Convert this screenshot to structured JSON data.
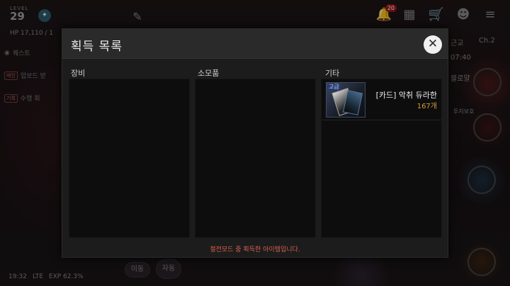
{
  "hud": {
    "level_label": "LEVEL",
    "level": "29",
    "hp": "HP 17,110 / 1",
    "quests": [
      {
        "tag": "",
        "text": "퀘스트"
      },
      {
        "tag": "메인",
        "text": "업보드 받"
      },
      {
        "tag": "기록",
        "text": "수행 회"
      }
    ],
    "notification_count": "20",
    "right_labels": [
      "근교",
      "Ch.2"
    ],
    "clock_right": "07:40",
    "side_label_1": "블로얄",
    "side_label_2": "투지보호",
    "bottom_status": {
      "time": "19:32",
      "network": "LTE",
      "exp": "EXP 62.3%"
    },
    "move_button": "이동",
    "auto_button": "자동"
  },
  "modal": {
    "title": "획득 목록",
    "close_icon": "close-icon",
    "columns": [
      {
        "label": "장비",
        "items": []
      },
      {
        "label": "소모품",
        "items": []
      },
      {
        "label": "기타",
        "items": [
          {
            "icon": "card-icon",
            "grade": "고급",
            "name": "[카드] 악취 듀라한",
            "count": "167개"
          }
        ]
      }
    ],
    "footer": "절전모드 중 획득한 아이템입니다."
  },
  "colors": {
    "accent_count": "#d89a3c",
    "footer_text": "#d86050",
    "modal_bg": "#1c1c1c",
    "panel_bg": "#0d0d0d"
  }
}
